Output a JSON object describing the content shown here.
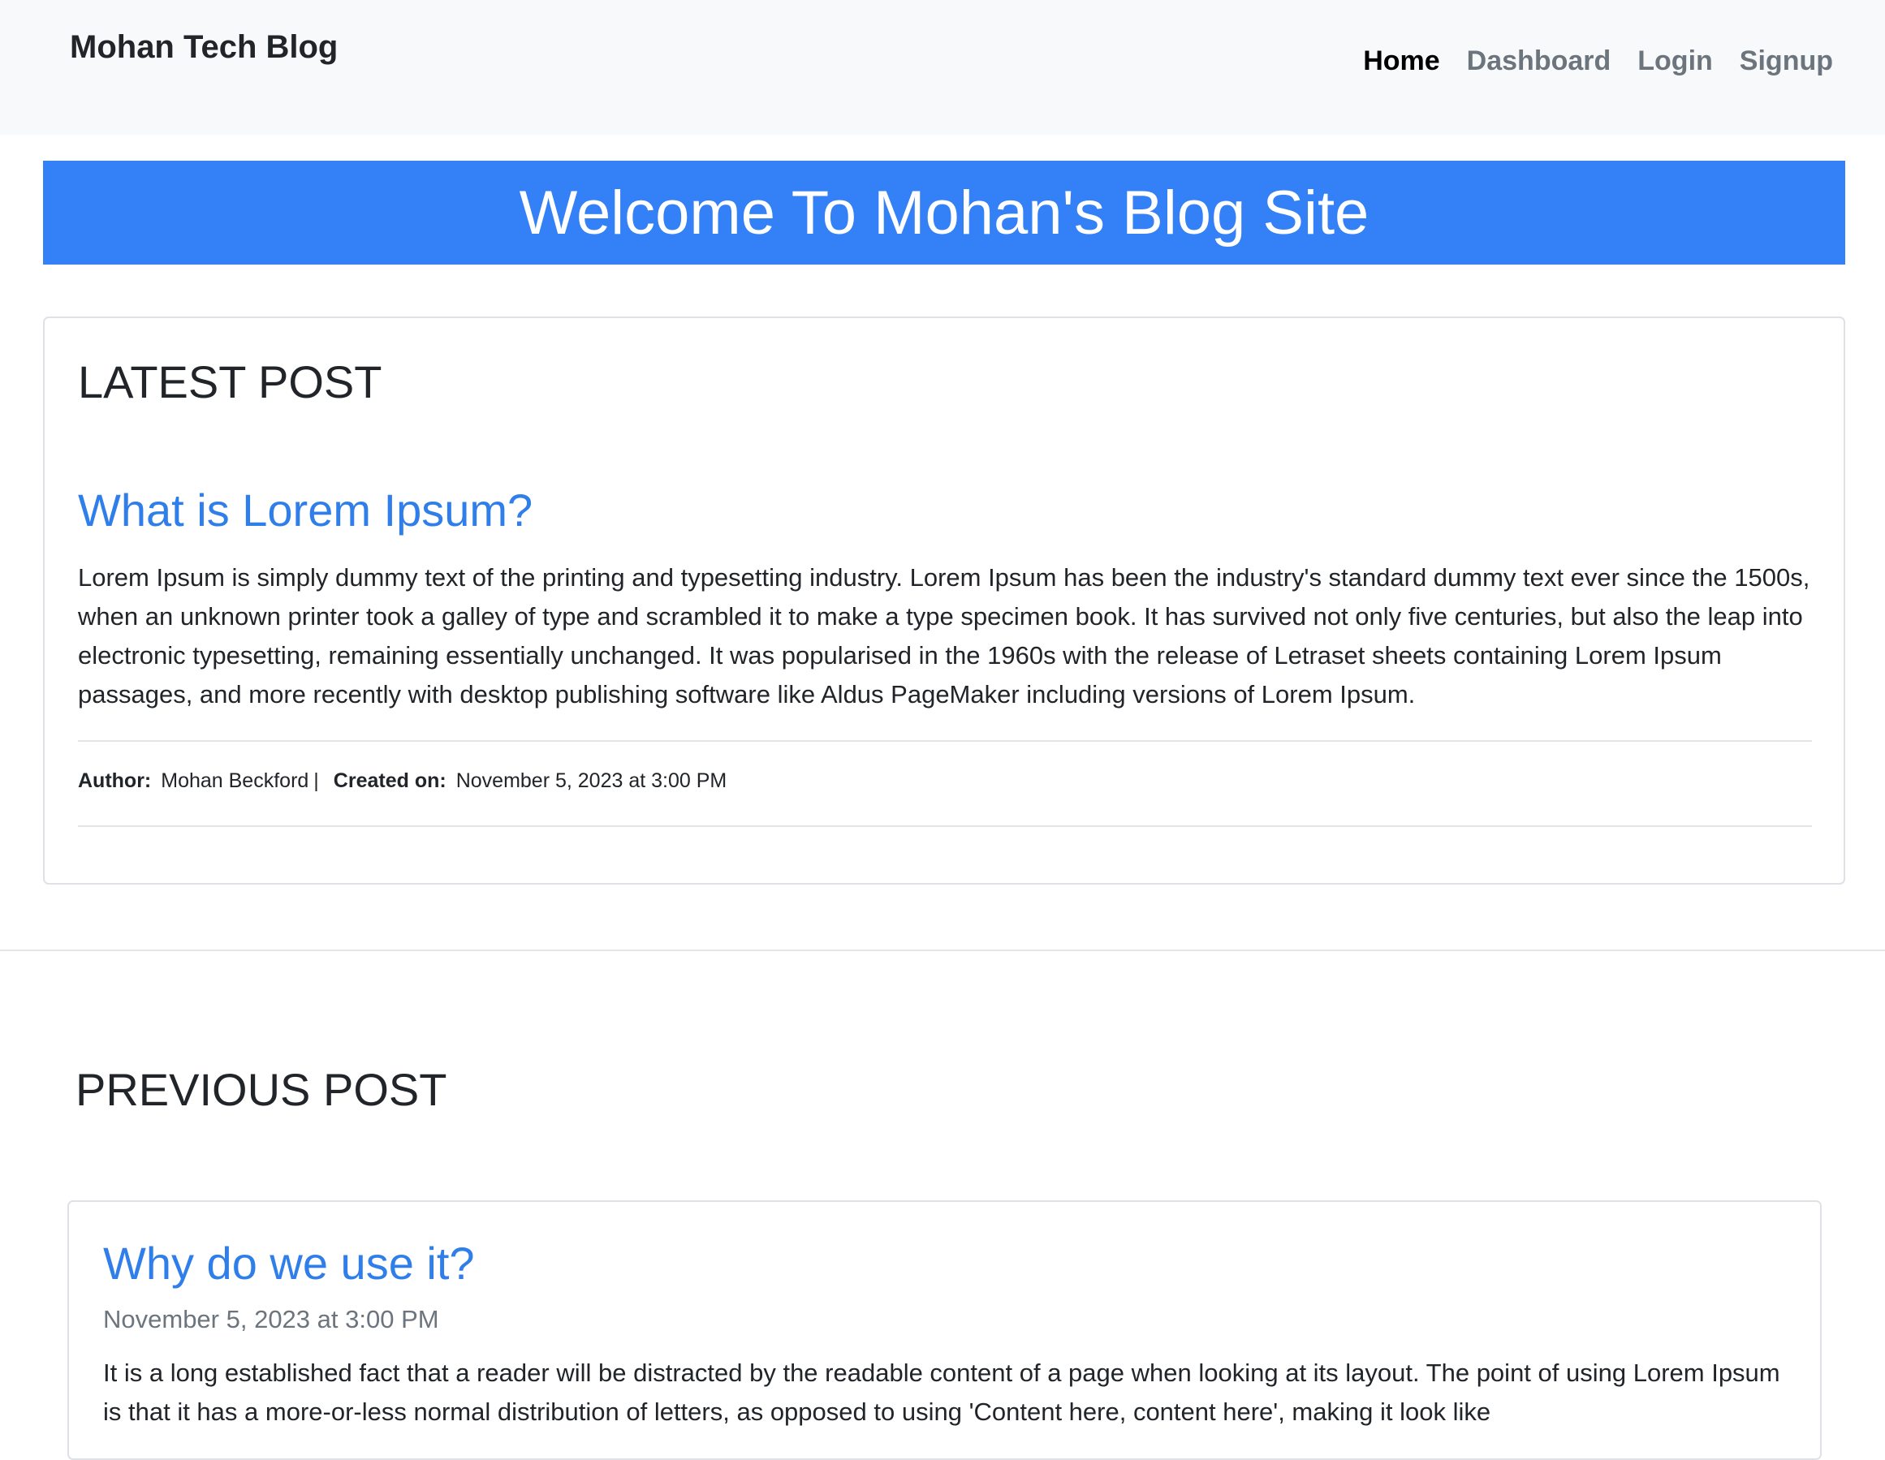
{
  "navbar": {
    "brand": "Mohan Tech Blog",
    "links": [
      {
        "label": "Home",
        "active": true
      },
      {
        "label": "Dashboard",
        "active": false
      },
      {
        "label": "Login",
        "active": false
      },
      {
        "label": "Signup",
        "active": false
      }
    ]
  },
  "banner": {
    "title": "Welcome To Mohan's Blog Site",
    "color": "#3380f7"
  },
  "latest": {
    "heading": "LATEST POST",
    "post": {
      "title": "What is Lorem Ipsum?",
      "body": "Lorem Ipsum is simply dummy text of the printing and typesetting industry. Lorem Ipsum has been the industry's standard dummy text ever since the 1500s, when an unknown printer took a galley of type and scrambled it to make a type specimen book. It has survived not only five centuries, but also the leap into electronic typesetting, remaining essentially unchanged. It was popularised in the 1960s with the release of Letraset sheets containing Lorem Ipsum passages, and more recently with desktop publishing software like Aldus PageMaker including versions of Lorem Ipsum.",
      "author_label": "Author:",
      "author": "Mohan Beckford",
      "separator": "|",
      "created_label": "Created on:",
      "created": "November 5, 2023 at 3:00 PM"
    }
  },
  "previous": {
    "heading": "PREVIOUS POST",
    "posts": [
      {
        "title": "Why do we use it?",
        "date": "November 5, 2023 at 3:00 PM",
        "body": "It is a long established fact that a reader will be distracted by the readable content of a page when looking at its layout. The point of using Lorem Ipsum is that it has a more-or-less normal distribution of letters, as opposed to using 'Content here, content here', making it look like"
      }
    ]
  },
  "colors": {
    "link_blue": "#2f7ee9",
    "navbar_bg": "#f8f9fa",
    "muted": "#6c757d"
  }
}
